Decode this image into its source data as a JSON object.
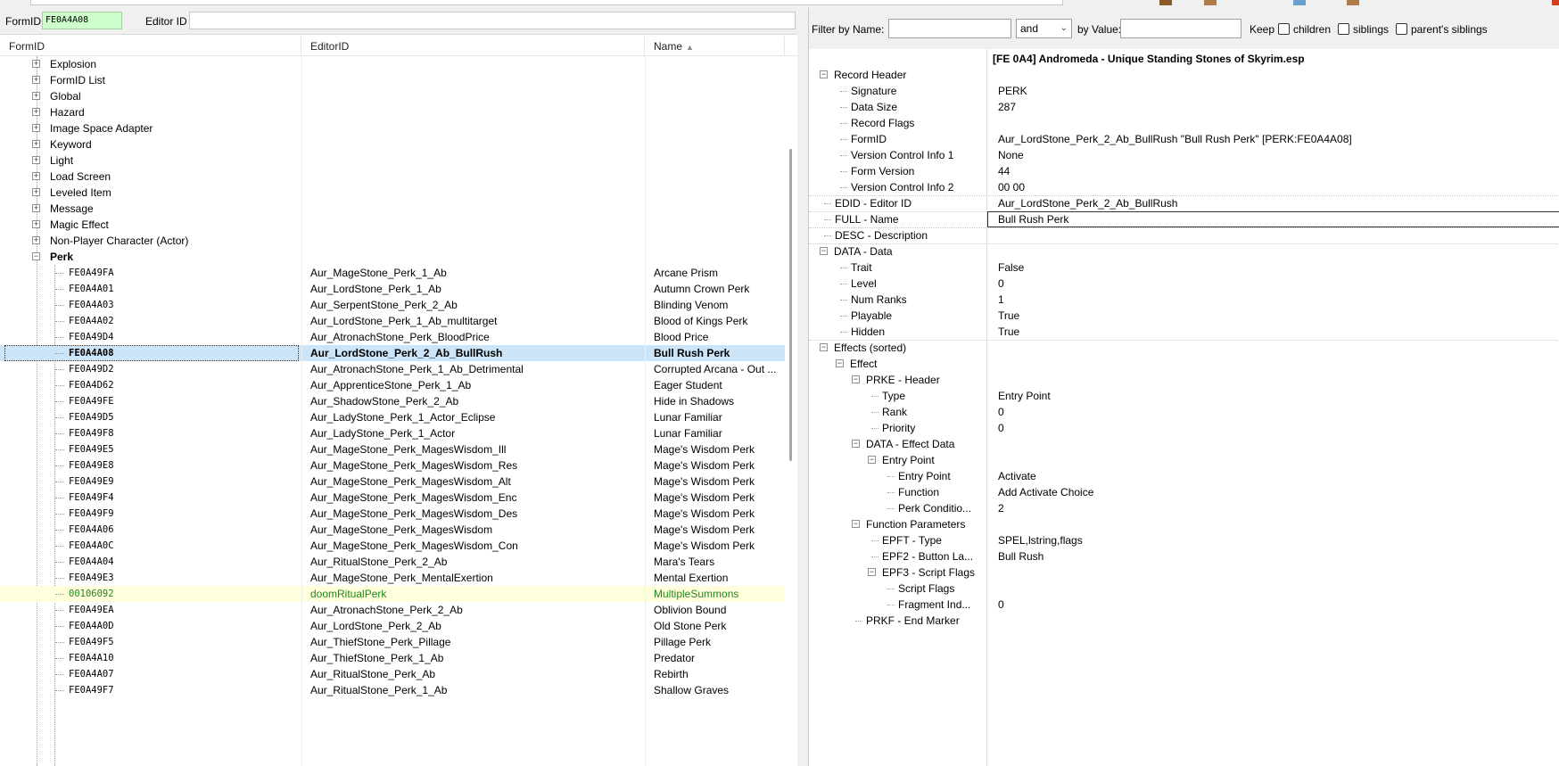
{
  "left": {
    "formid_label": "FormID",
    "formid_value": "FE0A4A08",
    "editorid_label": "Editor ID",
    "editorid_value": "",
    "columns": {
      "formid": "FormID",
      "editorid": "EditorID",
      "name": "Name"
    },
    "groups": [
      {
        "label": "Explosion"
      },
      {
        "label": "FormID List"
      },
      {
        "label": "Global"
      },
      {
        "label": "Hazard"
      },
      {
        "label": "Image Space Adapter"
      },
      {
        "label": "Keyword"
      },
      {
        "label": "Light"
      },
      {
        "label": "Load Screen"
      },
      {
        "label": "Leveled Item"
      },
      {
        "label": "Message"
      },
      {
        "label": "Magic Effect"
      },
      {
        "label": "Non-Player Character (Actor)"
      },
      {
        "label": "Perk"
      }
    ],
    "records": [
      {
        "formid": "FE0A49FA",
        "editorid": "Aur_MageStone_Perk_1_Ab",
        "name": "Arcane Prism"
      },
      {
        "formid": "FE0A4A01",
        "editorid": "Aur_LordStone_Perk_1_Ab",
        "name": "Autumn Crown Perk"
      },
      {
        "formid": "FE0A4A03",
        "editorid": "Aur_SerpentStone_Perk_2_Ab",
        "name": "Blinding Venom"
      },
      {
        "formid": "FE0A4A02",
        "editorid": "Aur_LordStone_Perk_1_Ab_multitarget",
        "name": "Blood of Kings Perk"
      },
      {
        "formid": "FE0A49D4",
        "editorid": "Aur_AtronachStone_Perk_BloodPrice",
        "name": "Blood Price"
      },
      {
        "formid": "FE0A4A08",
        "editorid": "Aur_LordStone_Perk_2_Ab_BullRush",
        "name": "Bull Rush Perk"
      },
      {
        "formid": "FE0A49D2",
        "editorid": "Aur_AtronachStone_Perk_1_Ab_Detrimental",
        "name": "Corrupted Arcana - Out ..."
      },
      {
        "formid": "FE0A4D62",
        "editorid": "Aur_ApprenticeStone_Perk_1_Ab",
        "name": "Eager Student"
      },
      {
        "formid": "FE0A49FE",
        "editorid": "Aur_ShadowStone_Perk_2_Ab",
        "name": "Hide in Shadows"
      },
      {
        "formid": "FE0A49D5",
        "editorid": "Aur_LadyStone_Perk_1_Actor_Eclipse",
        "name": "Lunar Familiar"
      },
      {
        "formid": "FE0A49F8",
        "editorid": "Aur_LadyStone_Perk_1_Actor",
        "name": "Lunar Familiar"
      },
      {
        "formid": "FE0A49E5",
        "editorid": "Aur_MageStone_Perk_MagesWisdom_Ill",
        "name": "Mage's Wisdom Perk"
      },
      {
        "formid": "FE0A49E8",
        "editorid": "Aur_MageStone_Perk_MagesWisdom_Res",
        "name": "Mage's Wisdom Perk"
      },
      {
        "formid": "FE0A49E9",
        "editorid": "Aur_MageStone_Perk_MagesWisdom_Alt",
        "name": "Mage's Wisdom Perk"
      },
      {
        "formid": "FE0A49F4",
        "editorid": "Aur_MageStone_Perk_MagesWisdom_Enc",
        "name": "Mage's Wisdom Perk"
      },
      {
        "formid": "FE0A49F9",
        "editorid": "Aur_MageStone_Perk_MagesWisdom_Des",
        "name": "Mage's Wisdom Perk"
      },
      {
        "formid": "FE0A4A06",
        "editorid": "Aur_MageStone_Perk_MagesWisdom",
        "name": "Mage's Wisdom Perk"
      },
      {
        "formid": "FE0A4A0C",
        "editorid": "Aur_MageStone_Perk_MagesWisdom_Con",
        "name": "Mage's Wisdom Perk"
      },
      {
        "formid": "FE0A4A04",
        "editorid": "Aur_RitualStone_Perk_2_Ab",
        "name": "Mara's Tears"
      },
      {
        "formid": "FE0A49E3",
        "editorid": "Aur_MageStone_Perk_MentalExertion",
        "name": "Mental Exertion"
      },
      {
        "formid": "00106092",
        "editorid": "doomRitualPerk",
        "name": "MultipleSummons"
      },
      {
        "formid": "FE0A49EA",
        "editorid": "Aur_AtronachStone_Perk_2_Ab",
        "name": "Oblivion Bound"
      },
      {
        "formid": "FE0A4A0D",
        "editorid": "Aur_LordStone_Perk_2_Ab",
        "name": "Old Stone Perk"
      },
      {
        "formid": "FE0A49F5",
        "editorid": "Aur_ThiefStone_Perk_Pillage",
        "name": "Pillage Perk"
      },
      {
        "formid": "FE0A4A10",
        "editorid": "Aur_ThiefStone_Perk_1_Ab",
        "name": "Predator"
      },
      {
        "formid": "FE0A4A07",
        "editorid": "Aur_RitualStone_Perk_Ab",
        "name": "Rebirth"
      },
      {
        "formid": "FE0A49F7",
        "editorid": "Aur_RitualStone_Perk_1_Ab",
        "name": "Shallow Graves"
      }
    ],
    "selected_index": 5,
    "highlight_index": 20
  },
  "filter": {
    "by_name_label": "Filter by Name:",
    "name_value": "",
    "operator": "and",
    "by_value_label": "by Value:",
    "value_value": "",
    "keep_label": "Keep",
    "children_label": "children",
    "siblings_label": "siblings",
    "parents_siblings_label": "parent's siblings"
  },
  "record_view": {
    "header": "[FE 0A4] Andromeda - Unique Standing Stones of Skyrim.esp",
    "rows": [
      {
        "label": "Record Header",
        "value": "",
        "exp": "-"
      },
      {
        "label": "Signature",
        "value": "PERK"
      },
      {
        "label": "Data Size",
        "value": "287"
      },
      {
        "label": "Record Flags",
        "value": ""
      },
      {
        "label": "FormID",
        "value": "Aur_LordStone_Perk_2_Ab_BullRush \"Bull Rush Perk\" [PERK:FE0A4A08]"
      },
      {
        "label": "Version Control Info 1",
        "value": "None"
      },
      {
        "label": "Form Version",
        "value": "44"
      },
      {
        "label": "Version Control Info 2",
        "value": "00 00"
      },
      {
        "label": "EDID - Editor ID",
        "value": "Aur_LordStone_Perk_2_Ab_BullRush"
      },
      {
        "label": "FULL - Name",
        "value": "Bull Rush Perk"
      },
      {
        "label": "DESC - Description",
        "value": ""
      },
      {
        "label": "DATA - Data",
        "value": "",
        "exp": "-"
      },
      {
        "label": "Trait",
        "value": "False"
      },
      {
        "label": "Level",
        "value": "0"
      },
      {
        "label": "Num Ranks",
        "value": "1"
      },
      {
        "label": "Playable",
        "value": "True"
      },
      {
        "label": "Hidden",
        "value": "True"
      },
      {
        "label": "Effects (sorted)",
        "value": "",
        "exp": "-"
      },
      {
        "label": "Effect",
        "value": "",
        "exp": "-"
      },
      {
        "label": "PRKE - Header",
        "value": "",
        "exp": "-"
      },
      {
        "label": "Type",
        "value": "Entry Point"
      },
      {
        "label": "Rank",
        "value": "0"
      },
      {
        "label": "Priority",
        "value": "0"
      },
      {
        "label": "DATA - Effect Data",
        "value": "",
        "exp": "-"
      },
      {
        "label": "Entry Point",
        "value": "",
        "exp": "-"
      },
      {
        "label": "Entry Point",
        "value": "Activate"
      },
      {
        "label": "Function",
        "value": "Add Activate Choice"
      },
      {
        "label": "Perk Conditio...",
        "value": "2"
      },
      {
        "label": "Function Parameters",
        "value": "",
        "exp": "-"
      },
      {
        "label": "EPFT - Type",
        "value": "SPEL,lstring,flags"
      },
      {
        "label": "EPF2 - Button La...",
        "value": "Bull Rush"
      },
      {
        "label": "EPF3 - Script Flags",
        "value": "",
        "exp": "-"
      },
      {
        "label": "Script Flags",
        "value": ""
      },
      {
        "label": "Fragment Ind...",
        "value": "0"
      },
      {
        "label": "PRKF - End Marker",
        "value": ""
      }
    ]
  },
  "colors": {
    "selected_row": "#cce4f7",
    "formid_field": "#ccffcc",
    "highlight_row": "#ffffdd",
    "highlight_text": "#22881a"
  }
}
